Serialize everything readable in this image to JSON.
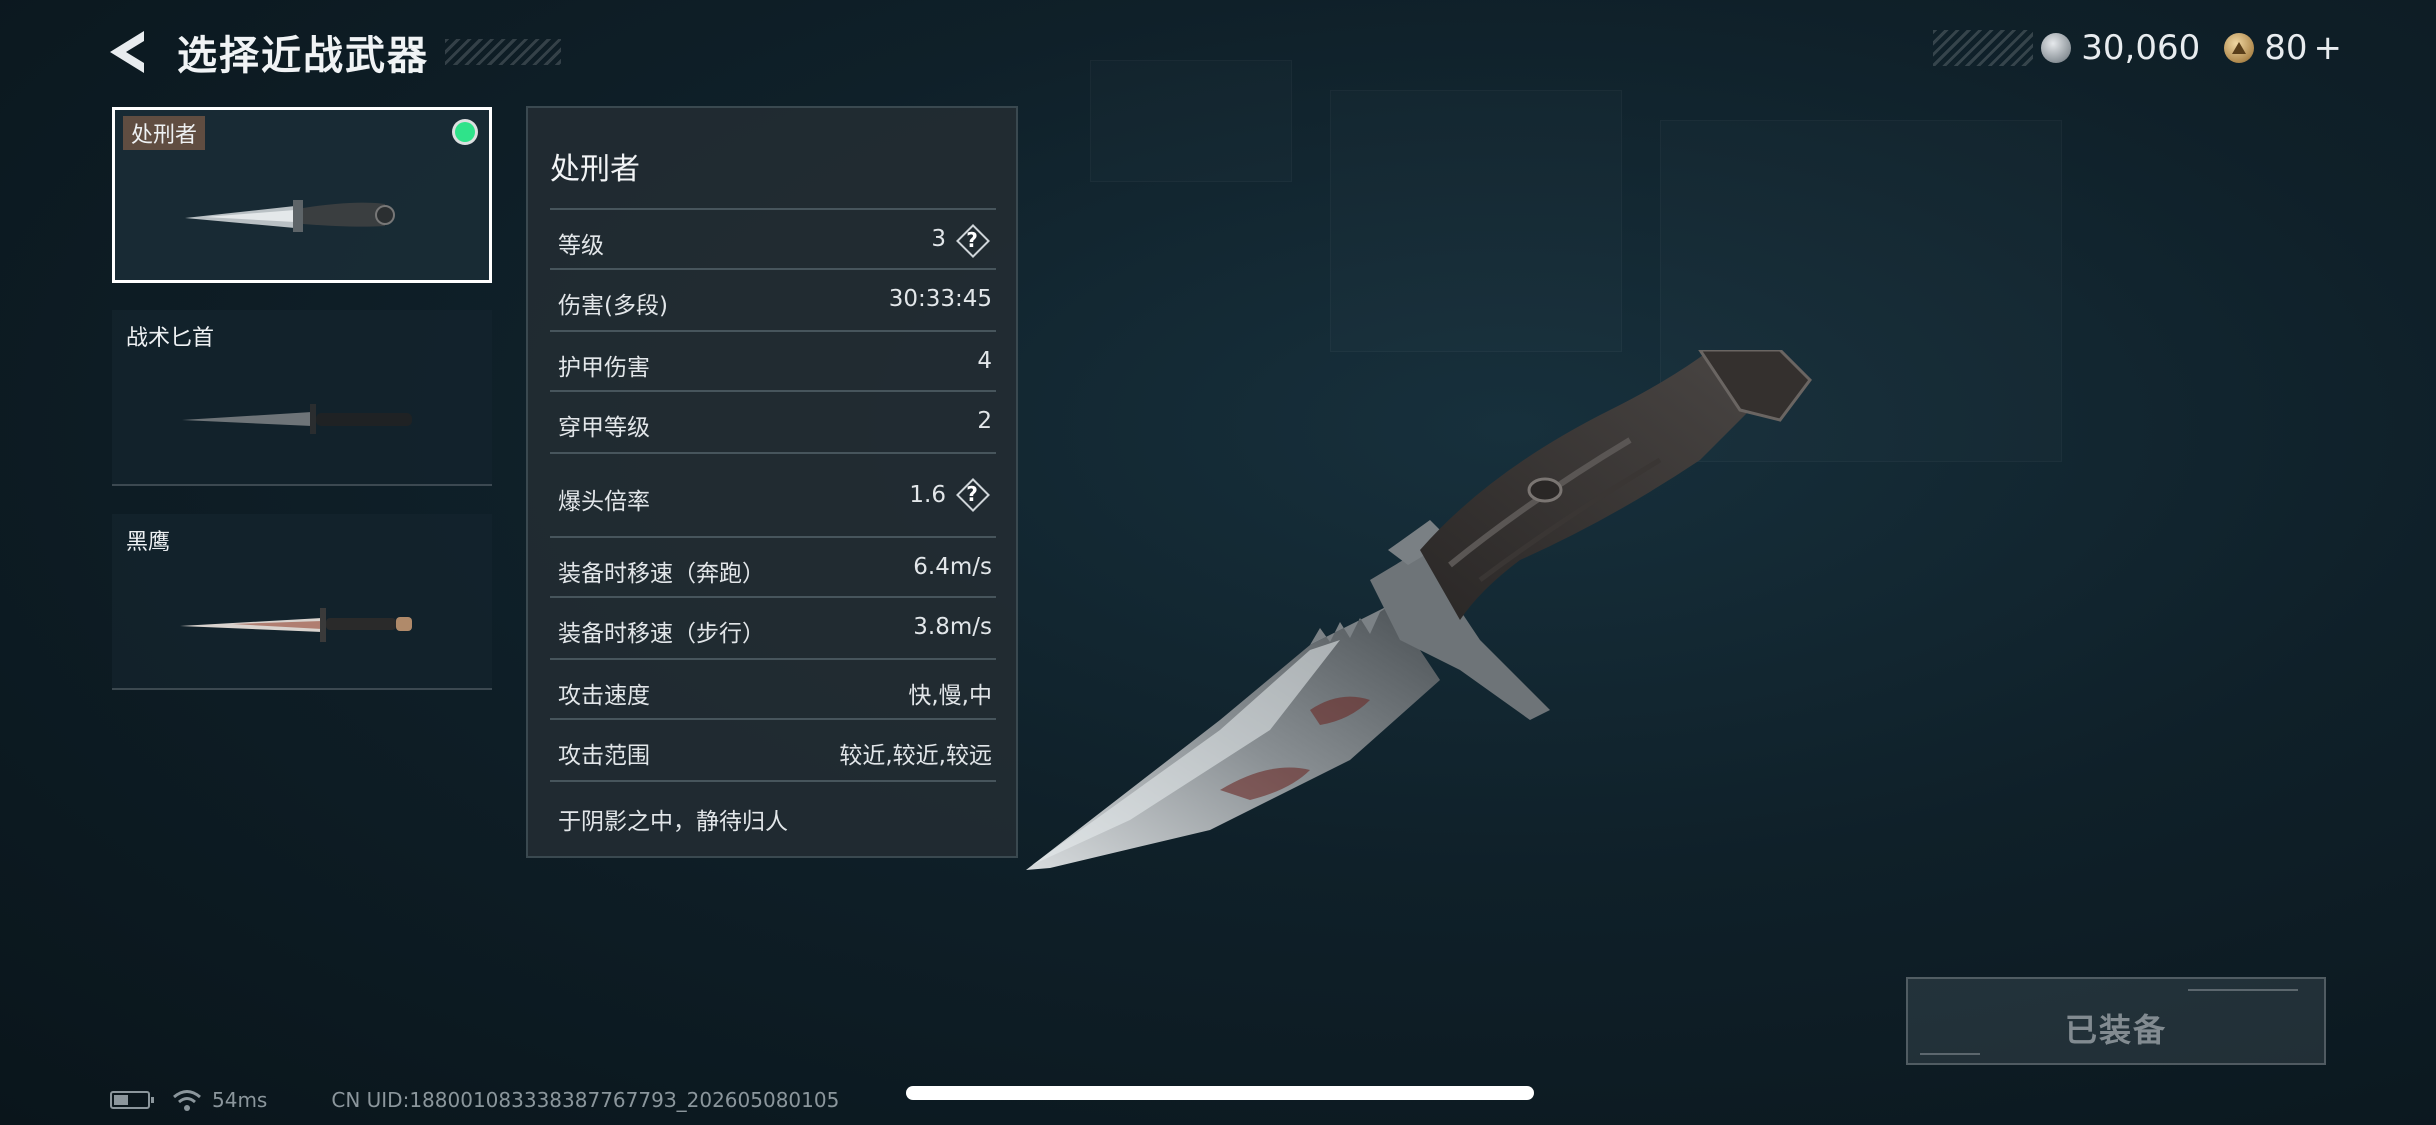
{
  "header": {
    "title": "选择近战武器"
  },
  "currency": {
    "silver": "30,060",
    "gold": "80",
    "add_symbol": "+",
    "silver_icon": "silver-coin-icon",
    "gold_icon": "gold-coin-icon"
  },
  "weapon_list": [
    {
      "name": "处刑者",
      "selected": true,
      "equipped": true
    },
    {
      "name": "战术匕首",
      "selected": false,
      "equipped": false
    },
    {
      "name": "黑鹰",
      "selected": false,
      "equipped": false
    }
  ],
  "details": {
    "name": "处刑者",
    "stats": [
      {
        "label": "等级",
        "value": "3",
        "help": true
      },
      {
        "label": "伤害(多段)",
        "value": "30:33:45",
        "help": false
      },
      {
        "label": "护甲伤害",
        "value": "4",
        "help": false
      },
      {
        "label": "穿甲等级",
        "value": "2",
        "help": false
      },
      {
        "label": "爆头倍率",
        "value": "1.6",
        "help": true
      },
      {
        "label": "装备时移速（奔跑）",
        "value": "6.4m/s",
        "help": false
      },
      {
        "label": "装备时移速（步行）",
        "value": "3.8m/s",
        "help": false
      },
      {
        "label": "攻击速度",
        "value": "快,慢,中",
        "help": false
      },
      {
        "label": "攻击范围",
        "value": "较近,较近,较远",
        "help": false
      }
    ],
    "help_symbol": "?",
    "description": "于阴影之中，静待归人"
  },
  "equip_button": {
    "label": "已装备"
  },
  "status": {
    "battery_level": 0.4,
    "ping": "54ms",
    "uid": "CN UID:18800108333838776779З_202605080105"
  },
  "colors": {
    "accent_green": "#2fe38a",
    "panel_bg": "#222c32",
    "background": "#0f2029"
  }
}
